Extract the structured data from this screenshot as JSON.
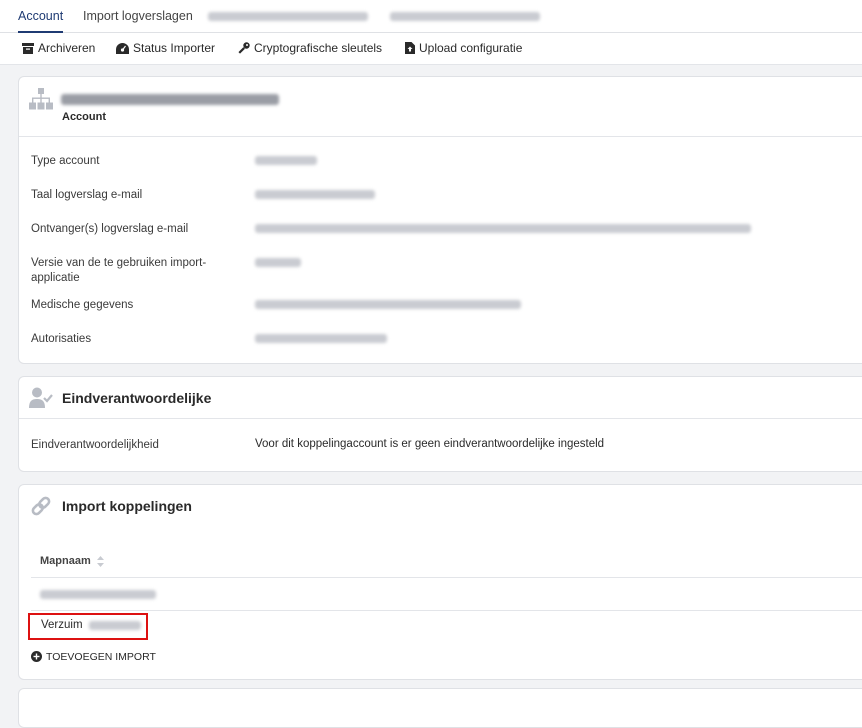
{
  "tabs": [
    {
      "label": "Account",
      "active": true
    },
    {
      "label": "Import logverslagen",
      "active": false
    },
    {
      "label": "",
      "redacted": true
    },
    {
      "label": "",
      "redacted": true
    }
  ],
  "toolbar": {
    "archive_label": "Archiveren",
    "status_label": "Status Importer",
    "keys_label": "Cryptografische sleutels",
    "upload_label": "Upload configuratie"
  },
  "account_card": {
    "subtitle": "Account",
    "icon": "sitemap-icon",
    "rows": [
      {
        "label": "Type account"
      },
      {
        "label": "Taal logverslag e-mail"
      },
      {
        "label": "Ontvanger(s) logverslag e-mail"
      },
      {
        "label": "Versie van de te gebruiken import-applicatie"
      },
      {
        "label": "Medische gegevens"
      },
      {
        "label": "Autorisaties"
      }
    ]
  },
  "responsible_card": {
    "title": "Eindverantwoordelijke",
    "icon": "user-check-icon",
    "label": "Eindverantwoordelijkheid",
    "value": "Voor dit koppelingaccount is er geen eindverantwoordelijke ingesteld"
  },
  "import_card": {
    "title": "Import koppelingen",
    "icon": "link-icon",
    "column_header": "Mapnaam",
    "rows": [
      {
        "prefix": "",
        "redacted": true
      },
      {
        "prefix": "Verzuim",
        "redacted": true,
        "highlighted": true
      }
    ],
    "add_label": "TOEVOEGEN IMPORT"
  },
  "colors": {
    "accent": "#1f3b73",
    "highlight": "#dd1111",
    "icon_gray": "#b8bcc4"
  }
}
